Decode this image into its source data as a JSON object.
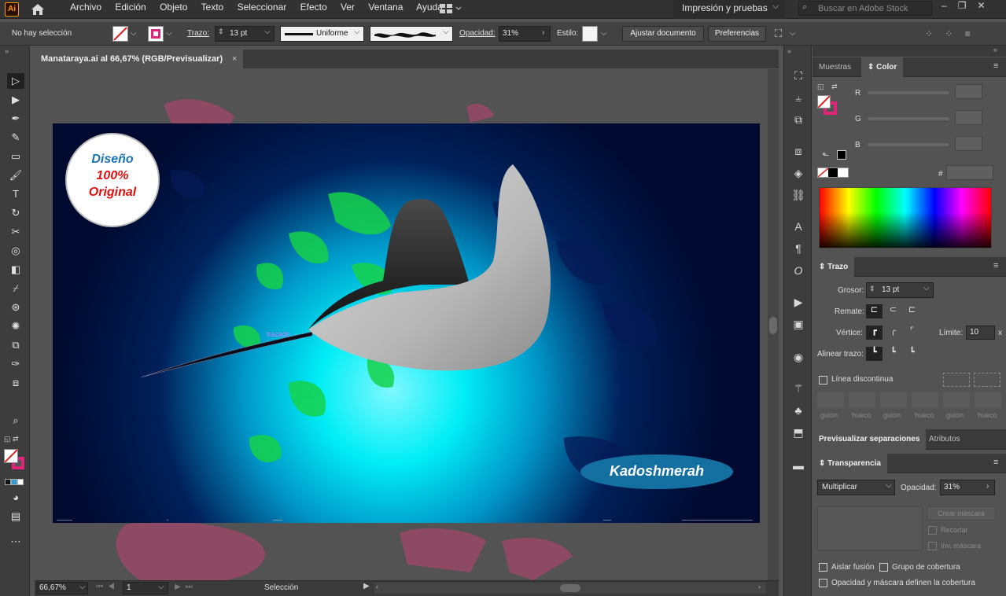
{
  "menubar": {
    "app_icon": "Ai",
    "menus": [
      "Archivo",
      "Edición",
      "Objeto",
      "Texto",
      "Seleccionar",
      "Efecto",
      "Ver",
      "Ventana",
      "Ayuda"
    ],
    "workspace": "Impresión y pruebas",
    "stock_search_placeholder": "Buscar en Adobe Stock"
  },
  "control": {
    "selection_status": "No hay selección",
    "stroke_label": "Trazo:",
    "stroke_value": "13 pt",
    "profile": "Uniforme",
    "opacity_label": "Opacidad:",
    "opacity_value": "31%",
    "style_label": "Estilo:",
    "adjust_btn": "Ajustar documento",
    "prefs_btn": "Preferencias"
  },
  "document": {
    "tab_title": "Manataraya.ai al 66,67% (RGB/Previsualizar)",
    "badge_line1": "Diseño",
    "badge_line2": "100%",
    "badge_line3": "Original",
    "signature": "Kadoshmerah",
    "path_hint": "trazado"
  },
  "status": {
    "zoom": "66,67%",
    "artboard_num": "1",
    "tool_name": "Selección"
  },
  "panels": {
    "color_tabs": [
      "Muestras",
      "Color"
    ],
    "rgb_labels": [
      "R",
      "G",
      "B"
    ],
    "hex_label": "#",
    "stroke_panel": {
      "title": "Trazo",
      "weight_label": "Grosor:",
      "weight_value": "13 pt",
      "cap_label": "Remate:",
      "corner_label": "Vértice:",
      "limit_label": "Límite:",
      "limit_value": "10",
      "limit_unit": "x",
      "align_label": "Alinear trazo:",
      "dashed_label": "Línea discontinua",
      "dash_fields": [
        "guión",
        "hueco",
        "guión",
        "hueco",
        "guión",
        "hueco"
      ]
    },
    "sep_tabs": [
      "Previsualizar separaciones",
      "Atributos"
    ],
    "transparency": {
      "title": "Transparencia",
      "blend": "Multiplicar",
      "opacity_label": "Opacidad:",
      "opacity_value": "31%",
      "make_mask": "Crear máscara",
      "clip": "Recortar",
      "invert": "Inv. máscara",
      "isolate": "Aislar fusión",
      "knockout": "Grupo de cobertura",
      "opacity_mask": "Opacidad y máscara definen la cobertura"
    }
  },
  "colors": {
    "accent": "#e0247a",
    "signature_bg": "#1470a0",
    "badge_blue": "#1a73b0",
    "badge_red": "#e01010",
    "glow": "#00e8f0",
    "artboard_bg": "#000a30"
  }
}
